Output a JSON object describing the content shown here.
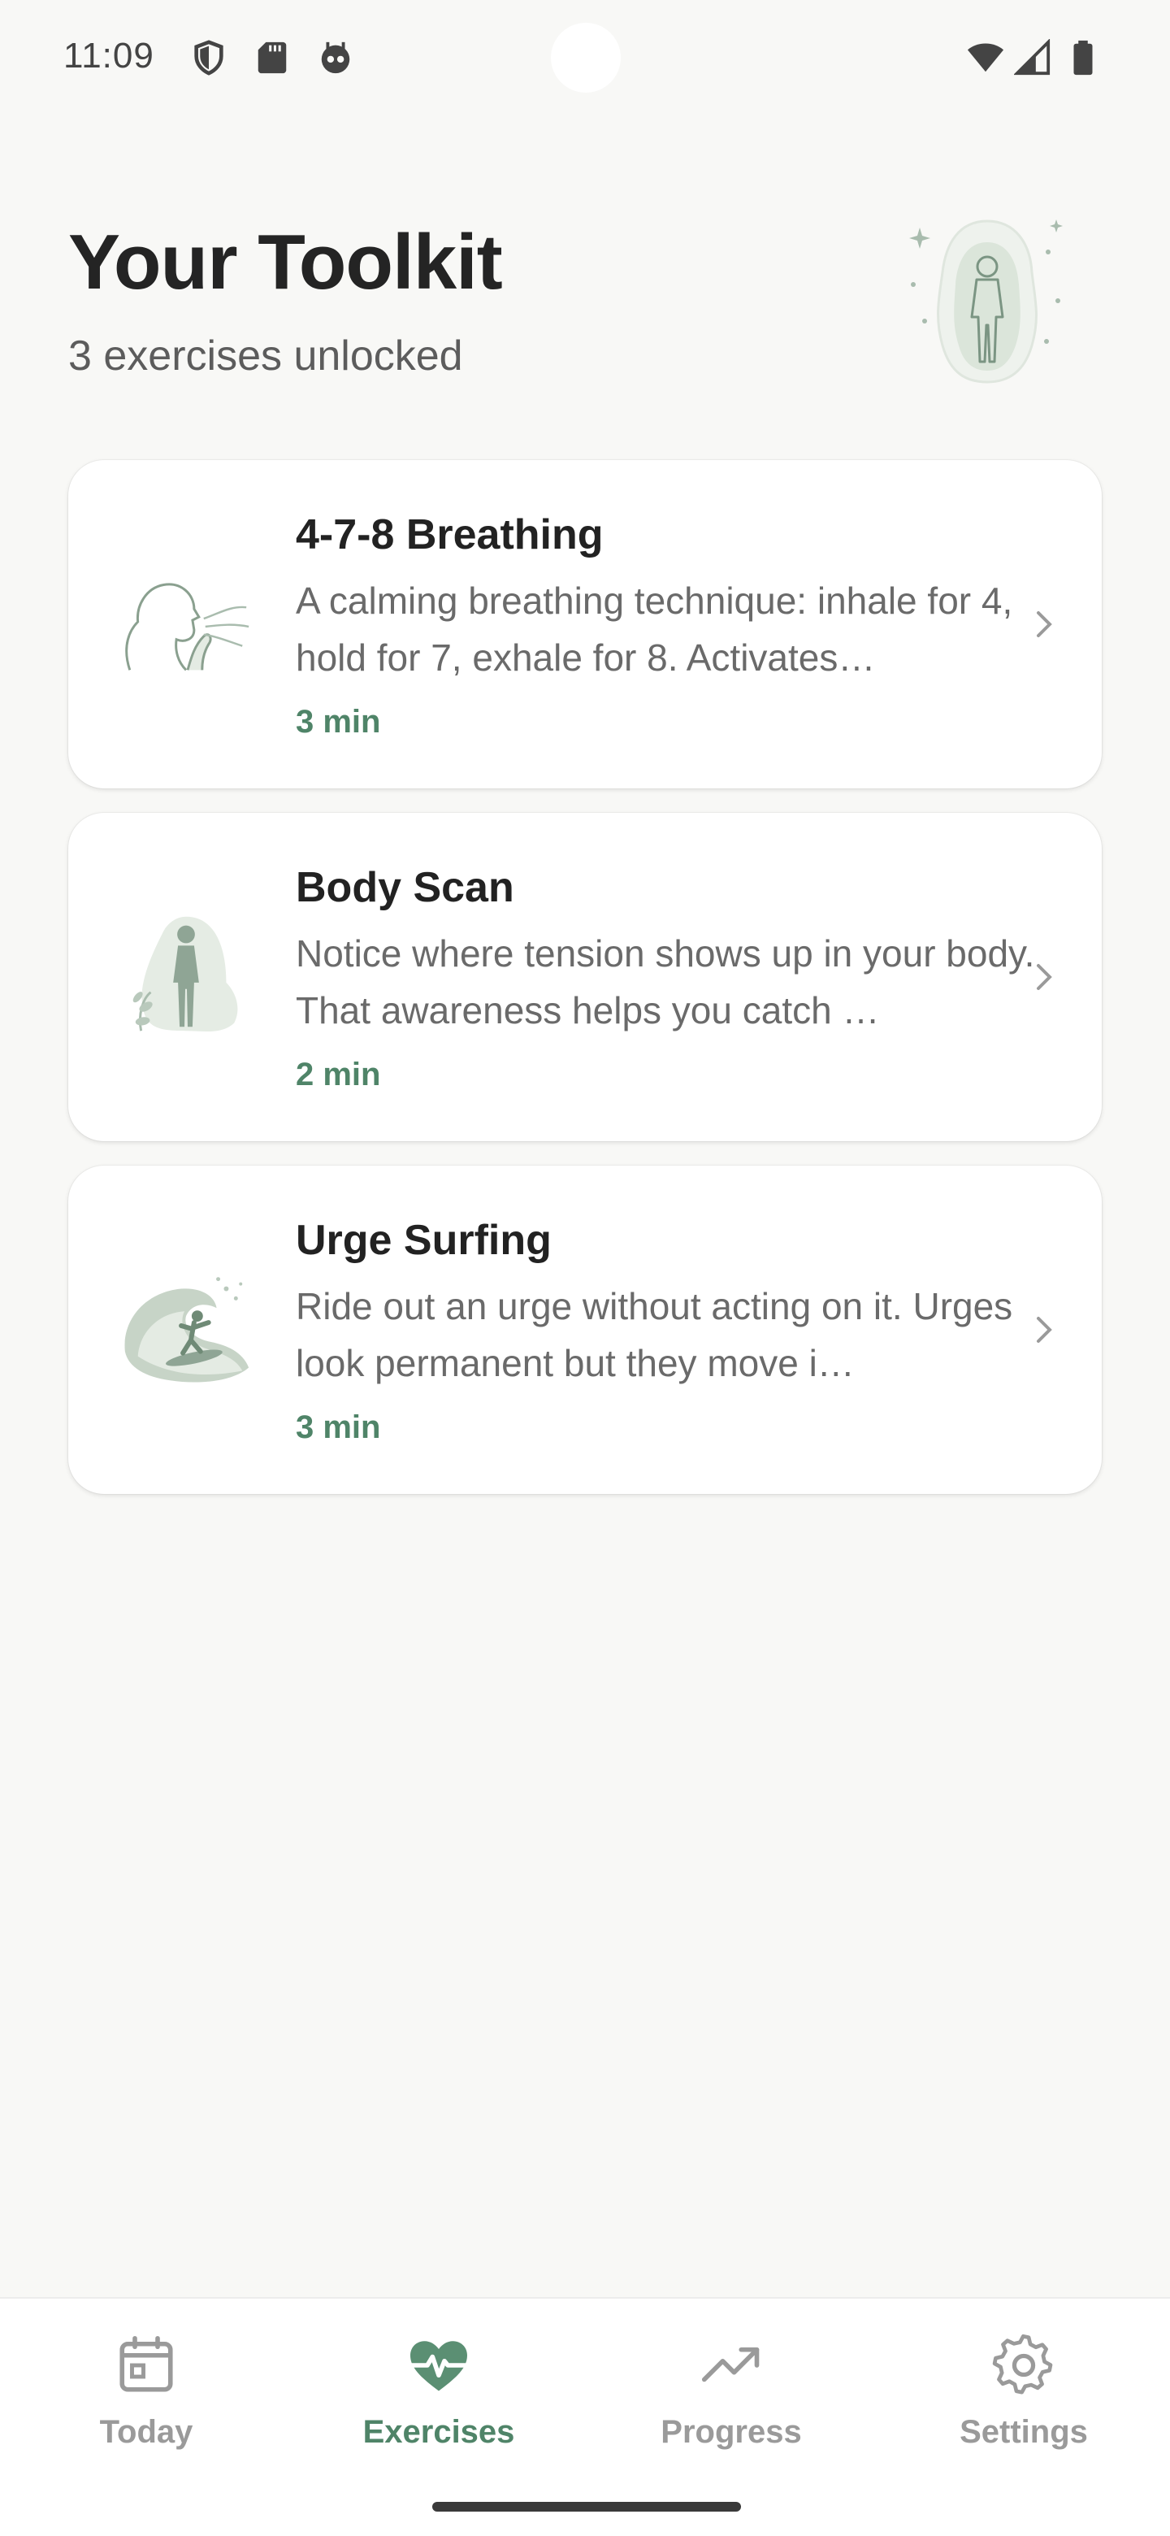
{
  "status_bar": {
    "time": "11:09",
    "left_icons": [
      "shield-icon",
      "sd-card-icon",
      "robot-icon"
    ],
    "right_icons": [
      "wifi-icon",
      "cell-signal-icon",
      "battery-icon"
    ]
  },
  "header": {
    "title": "Your Toolkit",
    "subtitle": "3 exercises unlocked",
    "illustration": "body-glow-illustration"
  },
  "exercises": [
    {
      "title": "4-7-8 Breathing",
      "description": "A calming breathing technique: inhale for 4, hold for 7, exhale for 8. Activates…",
      "duration": "3 min",
      "illustration": "breathing-face-illustration"
    },
    {
      "title": "Body Scan",
      "description": "Notice where tension shows up in your body. That awareness helps you catch …",
      "duration": "2 min",
      "illustration": "body-figure-illustration"
    },
    {
      "title": "Urge Surfing",
      "description": "Ride out an urge without acting on it. Urges look permanent but they move i…",
      "duration": "3 min",
      "illustration": "wave-surfer-illustration"
    }
  ],
  "bottom_nav": {
    "items": [
      {
        "label": "Today",
        "icon": "calendar-icon",
        "active": false
      },
      {
        "label": "Exercises",
        "icon": "heart-pulse-icon",
        "active": true
      },
      {
        "label": "Progress",
        "icon": "trending-up-icon",
        "active": false
      },
      {
        "label": "Settings",
        "icon": "gear-icon",
        "active": false
      }
    ]
  },
  "colors": {
    "background": "#f8f8f6",
    "accent": "#4f8468",
    "illustration_green": "#9fb4a3",
    "inactive": "#9a9a9a"
  }
}
